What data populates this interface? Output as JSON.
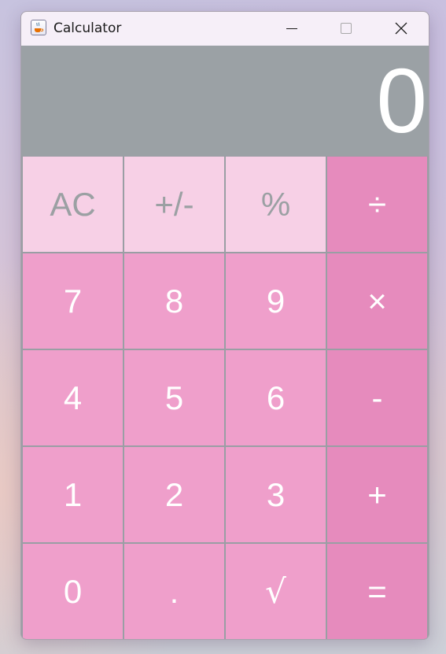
{
  "window": {
    "title": "Calculator",
    "icon": "java-coffee-cup-icon"
  },
  "titlebar_controls": {
    "minimize": "minimize-icon",
    "maximize": "maximize-icon",
    "close": "close-icon"
  },
  "display": {
    "value": "0"
  },
  "keys": {
    "ac": "AC",
    "sign": "+/-",
    "percent": "%",
    "divide": "÷",
    "seven": "7",
    "eight": "8",
    "nine": "9",
    "multiply": "×",
    "four": "4",
    "five": "5",
    "six": "6",
    "minus": "-",
    "one": "1",
    "two": "2",
    "three": "3",
    "plus": "+",
    "zero": "0",
    "dot": ".",
    "sqrt": "√",
    "equals": "="
  },
  "colors": {
    "function_key_bg": "#f7d0e6",
    "function_key_text": "#9ba0a3",
    "number_key_bg": "#ef9fcb",
    "operator_key_bg": "#e68bbd",
    "display_bg": "#9ba1a5",
    "key_text": "#ffffff"
  }
}
